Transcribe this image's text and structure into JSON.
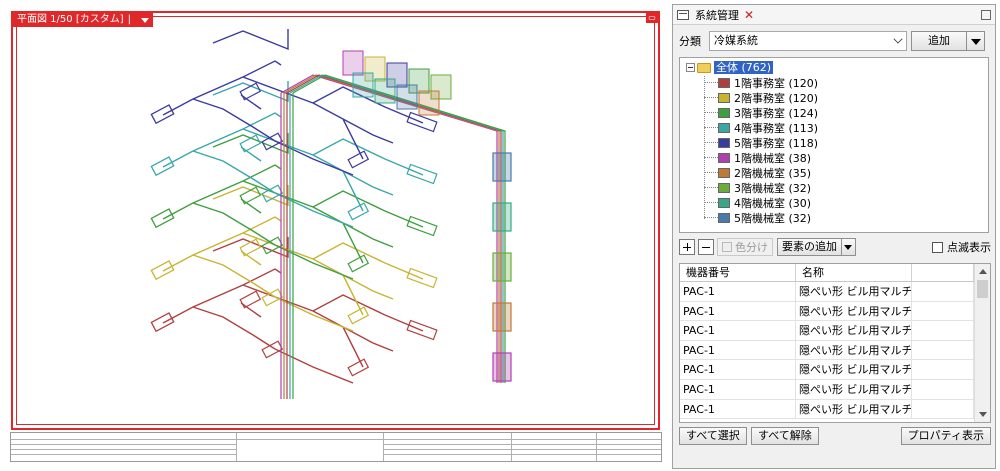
{
  "view": {
    "title": "平面図 1/50 [カスタム]",
    "separator": "|"
  },
  "panel": {
    "title": "系統管理",
    "category_label": "分類",
    "category_value": "冷媒系統",
    "add_label": "追加",
    "tree": {
      "root": "全体 (762)",
      "items": [
        {
          "label": "1階事務室 (120)",
          "color": "#b04040"
        },
        {
          "label": "2階事務室 (120)",
          "color": "#c8b431"
        },
        {
          "label": "3階事務室 (124)",
          "color": "#3f9f3f"
        },
        {
          "label": "4階事務室 (113)",
          "color": "#3aa7a7"
        },
        {
          "label": "5階事務室 (118)",
          "color": "#3b3b9f"
        },
        {
          "label": "1階機械室 (38)",
          "color": "#b040b0"
        },
        {
          "label": "2階機械室 (35)",
          "color": "#c07838"
        },
        {
          "label": "3階機械室 (32)",
          "color": "#6aad3a"
        },
        {
          "label": "4階機械室 (30)",
          "color": "#36a885"
        },
        {
          "label": "5階機械室 (32)",
          "color": "#4a7aa8"
        }
      ]
    },
    "toolbar": {
      "color_label": "色分け",
      "add_element_label": "要素の追加",
      "blink_label": "点滅表示"
    },
    "table": {
      "headers": [
        "機器番号",
        "名称",
        ""
      ],
      "rows": [
        [
          "PAC-1",
          "隠ぺい形 ビル用マルチ..."
        ],
        [
          "PAC-1",
          "隠ぺい形 ビル用マルチ..."
        ],
        [
          "PAC-1",
          "隠ぺい形 ビル用マルチ..."
        ],
        [
          "PAC-1",
          "隠ぺい形 ビル用マルチ..."
        ],
        [
          "PAC-1",
          "隠ぺい形 ビル用マルチ..."
        ],
        [
          "PAC-1",
          "隠ぺい形 ビル用マルチ..."
        ],
        [
          "PAC-1",
          "隠ぺい形 ビル用マルチ..."
        ]
      ]
    },
    "buttons": {
      "select_all": "すべて選択",
      "deselect_all": "すべて解除",
      "properties": "プロパティ表示"
    }
  }
}
